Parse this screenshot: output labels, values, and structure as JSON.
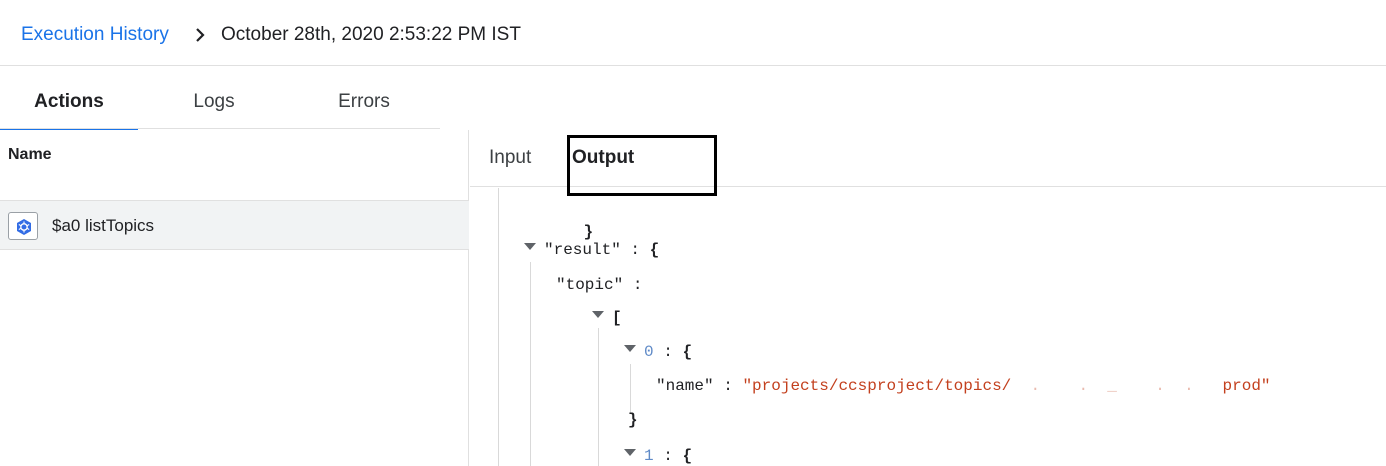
{
  "breadcrumb": {
    "parent": "Execution History",
    "current": "October 28th, 2020 2:53:22 PM IST"
  },
  "tabs": [
    {
      "label": "Actions",
      "active": true
    },
    {
      "label": "Logs",
      "active": false
    },
    {
      "label": "Errors",
      "active": false
    }
  ],
  "left_panel": {
    "column_header": "Name",
    "rows": [
      {
        "label": "$a0 listTopics",
        "icon": "kubernetes-helm-icon"
      }
    ]
  },
  "right_panel": {
    "sub_tabs": [
      {
        "label": "Input",
        "active": false
      },
      {
        "label": "Output",
        "active": true
      }
    ],
    "json": {
      "close_brace": "}",
      "result_key": "\"result\"",
      "topic_key": "\"topic\"",
      "array_open": "[",
      "item0_index": "0",
      "name_key": "\"name\"",
      "name_value": "\"projects/ccsproject/topics/",
      "name_value_end": "prod\"",
      "item1_index": "1",
      "colon": ":",
      "open_brace": "{"
    }
  },
  "colors": {
    "link": "#1a73e8",
    "string_value": "#c3401e",
    "index": "#5f8ac7"
  }
}
